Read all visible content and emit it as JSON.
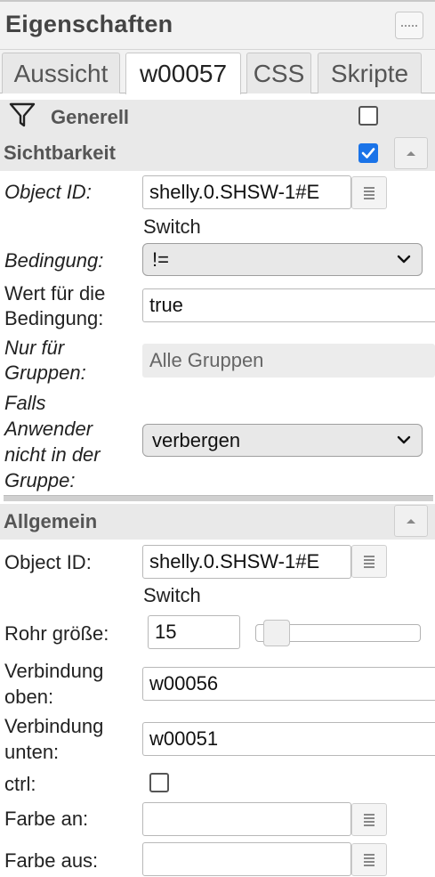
{
  "panel": {
    "title": "Eigenschaften"
  },
  "tabs": [
    {
      "label": "Aussicht"
    },
    {
      "label": "w00057"
    },
    {
      "label": "CSS"
    },
    {
      "label": "Skripte"
    }
  ],
  "generell": {
    "title": "Generell",
    "checked": false
  },
  "sichtbarkeit": {
    "title": "Sichtbarkeit",
    "checked": true,
    "object_id_label": "Object ID:",
    "object_id_value": "shelly.0.SHSW-1#E",
    "object_id_note": "Switch",
    "bedingung_label": "Bedingung:",
    "bedingung_value": "!=",
    "wert_label_1": "Wert für die",
    "wert_label_2": "Bedingung:",
    "wert_value": "true",
    "gruppen_label_1": "Nur für",
    "gruppen_label_2": "Gruppen:",
    "gruppen_value": "Alle Gruppen",
    "falls_label_1": "Falls",
    "falls_label_2": "Anwender",
    "falls_label_3": "nicht in der",
    "falls_label_4": "Gruppe:",
    "falls_value": "verbergen"
  },
  "allgemein": {
    "title": "Allgemein",
    "object_id_label": "Object ID:",
    "object_id_value": "shelly.0.SHSW-1#E",
    "object_id_note": "Switch",
    "rohr_label": "Rohr größe:",
    "rohr_value": "15",
    "verb_oben_label_1": "Verbindung",
    "verb_oben_label_2": "oben:",
    "verb_oben_value": "w00056",
    "verb_unten_label_1": "Verbindung",
    "verb_unten_label_2": "unten:",
    "verb_unten_value": "w00051",
    "ctrl_label": "ctrl:",
    "ctrl_checked": false,
    "farbe_an_label": "Farbe an:",
    "farbe_an_value": "",
    "farbe_aus_label": "Farbe aus:",
    "farbe_aus_value": ""
  },
  "colors": {
    "accent": "#1a73e8",
    "header_bg": "#f2f2f2",
    "section_bg": "#e9e9e9"
  },
  "icons": {
    "header_button": "grip-dots-icon",
    "filter": "filter-icon",
    "collapse": "chevron-up-icon",
    "picker": "list-picker-icon",
    "dropdown": "chevron-down-icon"
  }
}
